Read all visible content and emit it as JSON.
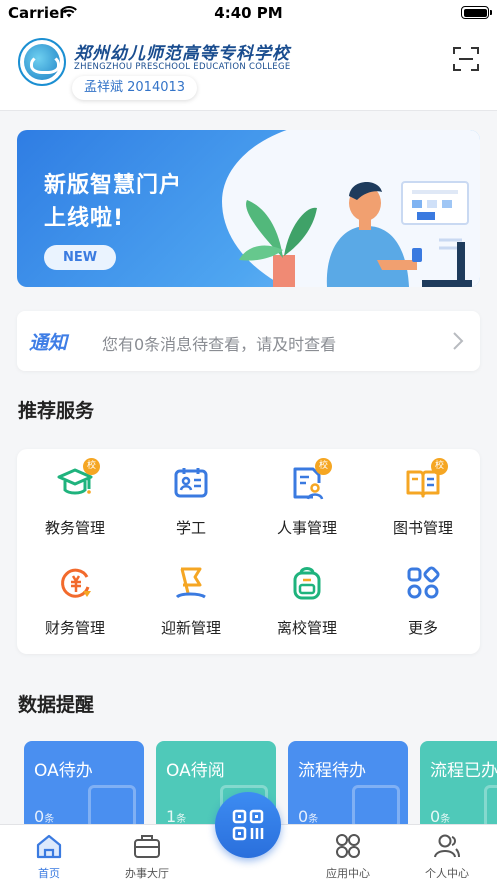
{
  "status_bar": {
    "carrier": "Carrier",
    "time": "4:40 PM"
  },
  "header": {
    "school_name_cn": "郑州幼儿师范高等专科学校",
    "school_name_en": "ZHENGZHOU PRESCHOOL EDUCATION COLLEGE",
    "user": "孟祥斌 2014013"
  },
  "banner": {
    "line1": "新版智慧门户",
    "line2": "上线啦!",
    "badge": "NEW"
  },
  "notice": {
    "tag": "通知",
    "text": "您有0条消息待查看，请及时查看"
  },
  "services": {
    "title": "推荐服务",
    "badge_label": "校",
    "items": [
      {
        "label": "教务管理",
        "icon": "graduation-cap-icon",
        "badge": true,
        "color": "#1fb37d"
      },
      {
        "label": "学工",
        "icon": "id-card-icon",
        "badge": false,
        "color": "#3a7ae0"
      },
      {
        "label": "人事管理",
        "icon": "personnel-file-icon",
        "badge": true,
        "color": "#3a7ae0"
      },
      {
        "label": "图书管理",
        "icon": "book-icon",
        "badge": true,
        "color": "#f5a623"
      },
      {
        "label": "财务管理",
        "icon": "finance-coin-icon",
        "badge": false,
        "color": "#f26a2c"
      },
      {
        "label": "迎新管理",
        "icon": "welcome-flag-icon",
        "badge": false,
        "color": "#f5a623"
      },
      {
        "label": "离校管理",
        "icon": "backpack-icon",
        "badge": false,
        "color": "#1fb37d"
      },
      {
        "label": "更多",
        "icon": "more-grid-icon",
        "badge": false,
        "color": "#3a7ae0"
      }
    ]
  },
  "data_reminders": {
    "title": "数据提醒",
    "cards": [
      {
        "title": "OA待办",
        "count": "0",
        "unit": "条",
        "color": "#4a8ff0"
      },
      {
        "title": "OA待阅",
        "count": "1",
        "unit": "条",
        "color": "#4fc9b9"
      },
      {
        "title": "流程待办",
        "count": "0",
        "unit": "条",
        "color": "#4a8ff0"
      },
      {
        "title": "流程已办",
        "count": "0",
        "unit": "条",
        "color": "#4fc9b9"
      }
    ]
  },
  "tabbar": {
    "items": [
      {
        "label": "首页",
        "icon": "home-icon",
        "active": true
      },
      {
        "label": "办事大厅",
        "icon": "briefcase-icon",
        "active": false
      },
      {
        "label": "应用中心",
        "icon": "apps-icon",
        "active": false
      },
      {
        "label": "个人中心",
        "icon": "user-icon",
        "active": false
      }
    ]
  },
  "colors": {
    "primary": "#3a7ae0",
    "background": "#f5f6f8"
  }
}
